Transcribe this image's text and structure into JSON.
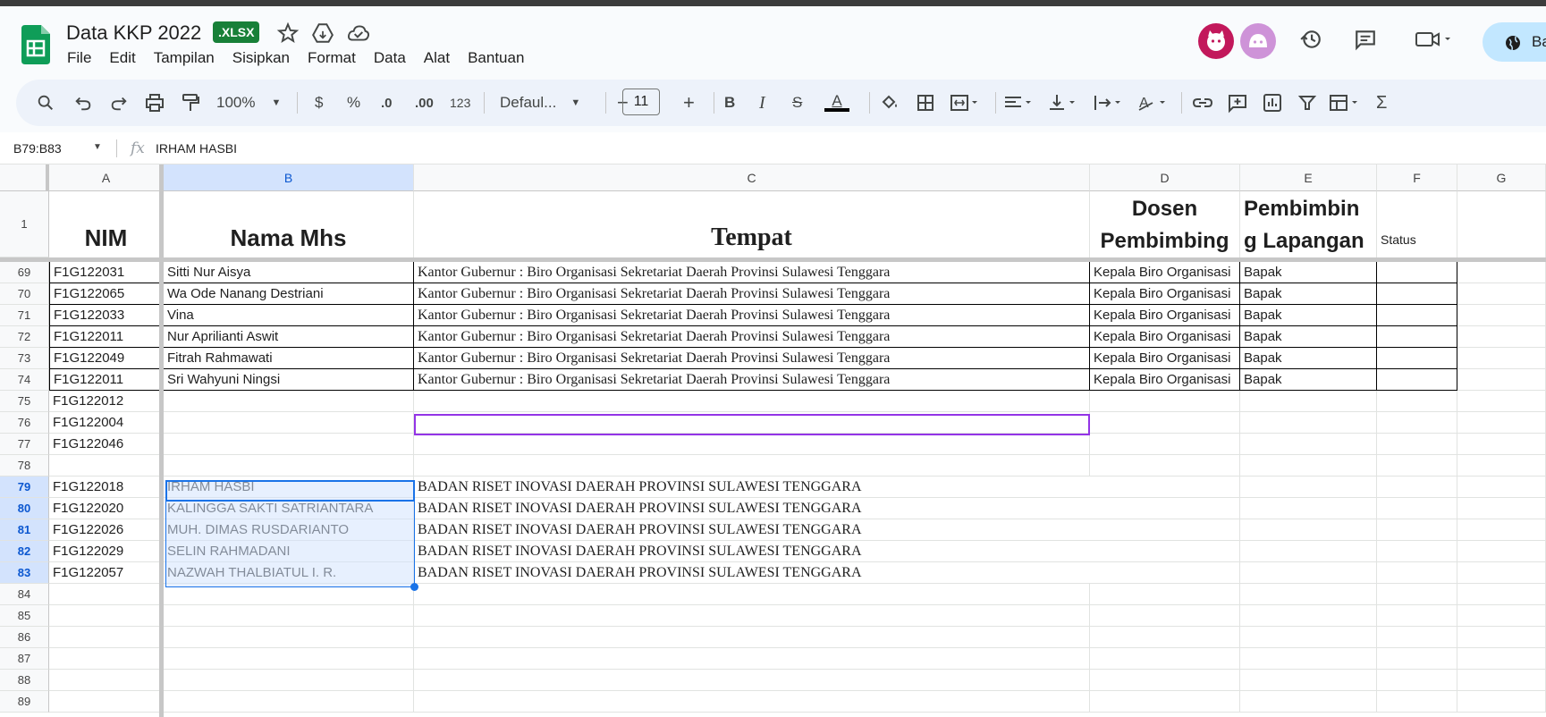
{
  "app": {
    "title": "Data KKP 2022",
    "badge": ".XLSX",
    "menu": [
      "File",
      "Edit",
      "Tampilan",
      "Sisipkan",
      "Format",
      "Data",
      "Alat",
      "Bantuan"
    ],
    "share_label": "Ba",
    "icons": [
      "star-icon",
      "move-to-drive-icon",
      "cloud-saved-icon",
      "history-icon",
      "comments-icon",
      "meet-icon"
    ]
  },
  "toolbar": {
    "zoom": "100%",
    "currency": "$",
    "percent": "%",
    "dec_decrease": ".0",
    "dec_increase": ".00",
    "number_format": "123",
    "font": "Defaul...",
    "font_size": "11",
    "bold": "B",
    "italic": "I",
    "text_color": "A",
    "sum": "Σ"
  },
  "formula_bar": {
    "name_box": "B79:B83",
    "fx": "fx",
    "value": "IRHAM HASBI"
  },
  "sheet": {
    "columns": [
      "A",
      "B",
      "C",
      "D",
      "E",
      "F",
      "G"
    ],
    "header_row": {
      "number": "1",
      "A": "NIM",
      "B": "Nama Mhs",
      "C": "Tempat",
      "D_line1": "Dosen",
      "D_line2": "Pembimbing",
      "E_line1": "Pembimbin",
      "E_line2": "g Lapangan",
      "F": "Status"
    },
    "rows": [
      {
        "n": "69",
        "A": "F1G122031",
        "B": "Sitti Nur Aisya",
        "C": "Kantor Gubernur : Biro Organisasi Sekretariat Daerah Provinsi Sulawesi Tenggara",
        "D": "Kepala Biro Organisasi",
        "E": "Bapak"
      },
      {
        "n": "70",
        "A": "F1G122065",
        "B": "Wa Ode Nanang Destriani",
        "C": "Kantor Gubernur : Biro Organisasi Sekretariat Daerah Provinsi Sulawesi Tenggara",
        "D": "Kepala Biro Organisasi",
        "E": "Bapak"
      },
      {
        "n": "71",
        "A": "F1G122033",
        "B": "Vina",
        "C": "Kantor Gubernur : Biro Organisasi Sekretariat Daerah Provinsi Sulawesi Tenggara",
        "D": "Kepala Biro Organisasi",
        "E": "Bapak"
      },
      {
        "n": "72",
        "A": "F1G122011",
        "B": "Nur Aprilianti Aswit",
        "C": "Kantor Gubernur : Biro Organisasi Sekretariat Daerah Provinsi Sulawesi Tenggara",
        "D": "Kepala Biro Organisasi",
        "E": "Bapak"
      },
      {
        "n": "73",
        "A": "F1G122049",
        "B": "Fitrah Rahmawati",
        "C": "Kantor Gubernur : Biro Organisasi Sekretariat Daerah Provinsi Sulawesi Tenggara",
        "D": "Kepala Biro Organisasi",
        "E": "Bapak"
      },
      {
        "n": "74",
        "A": "F1G122011",
        "B": "Sri Wahyuni Ningsi",
        "C": "Kantor Gubernur : Biro Organisasi Sekretariat Daerah Provinsi Sulawesi Tenggara",
        "D": "Kepala Biro Organisasi",
        "E": "Bapak"
      },
      {
        "n": "75",
        "A": "F1G122012",
        "B": "",
        "C": "",
        "D": "",
        "E": ""
      },
      {
        "n": "76",
        "A": "F1G122004",
        "B": "",
        "C": "",
        "D": "",
        "E": ""
      },
      {
        "n": "77",
        "A": "F1G122046",
        "B": "",
        "C": "",
        "D": "",
        "E": ""
      },
      {
        "n": "78",
        "A": "",
        "B": "",
        "C": "",
        "D": "",
        "E": ""
      },
      {
        "n": "79",
        "A": "F1G122018",
        "B": "IRHAM HASBI",
        "C": "BADAN RISET INOVASI DAERAH PROVINSI SULAWESI TENGGARA",
        "D": "",
        "E": ""
      },
      {
        "n": "80",
        "A": "F1G122020",
        "B": "KALINGGA SAKTI SATRIANTARA",
        "C": "BADAN RISET INOVASI DAERAH PROVINSI SULAWESI TENGGARA",
        "D": "",
        "E": ""
      },
      {
        "n": "81",
        "A": "F1G122026",
        "B": "MUH. DIMAS RUSDARIANTO",
        "C": "BADAN RISET INOVASI DAERAH PROVINSI SULAWESI TENGGARA",
        "D": "",
        "E": ""
      },
      {
        "n": "82",
        "A": "F1G122029",
        "B": "SELIN RAHMADANI",
        "C": "BADAN RISET INOVASI DAERAH PROVINSI SULAWESI TENGGARA",
        "D": "",
        "E": ""
      },
      {
        "n": "83",
        "A": "F1G122057",
        "B": "NAZWAH THALBIATUL I. R.",
        "C": "BADAN RISET INOVASI DAERAH PROVINSI SULAWESI TENGGARA",
        "D": "",
        "E": ""
      },
      {
        "n": "84",
        "A": "",
        "B": "",
        "C": "",
        "D": "",
        "E": ""
      },
      {
        "n": "85",
        "A": "",
        "B": "",
        "C": "",
        "D": "",
        "E": ""
      },
      {
        "n": "86",
        "A": "",
        "B": "",
        "C": "",
        "D": "",
        "E": ""
      },
      {
        "n": "87",
        "A": "",
        "B": "",
        "C": "",
        "D": "",
        "E": ""
      },
      {
        "n": "88",
        "A": "",
        "B": "",
        "C": "",
        "D": "",
        "E": ""
      },
      {
        "n": "89",
        "A": "",
        "B": "",
        "C": "",
        "D": "",
        "E": ""
      }
    ],
    "selected_rows": [
      "79",
      "80",
      "81",
      "82",
      "83"
    ],
    "selected_column": "B"
  },
  "colors": {
    "accent": "#1a73e8",
    "sheets_green": "#0f9d58",
    "xlsx_badge": "#188038",
    "highlight_box": "#9334e6"
  }
}
